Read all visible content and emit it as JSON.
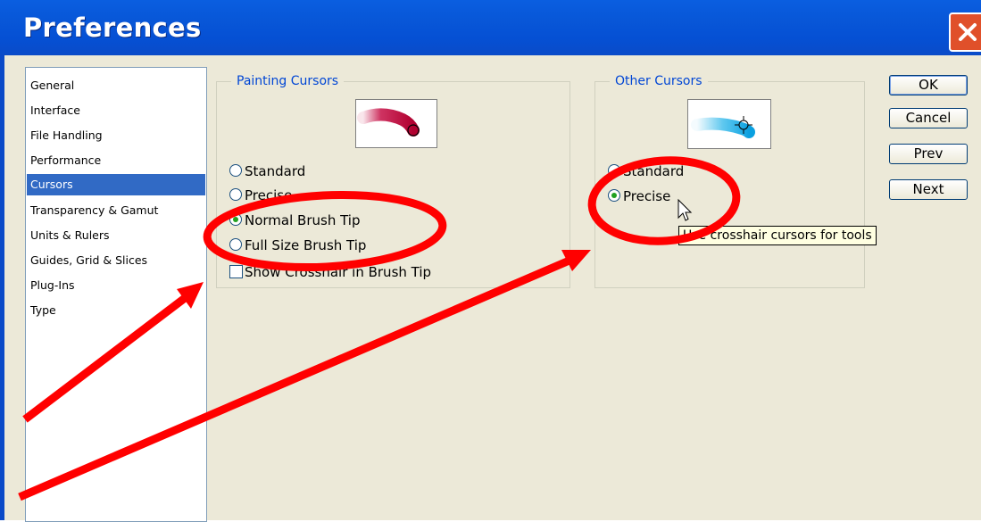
{
  "window": {
    "title": "Preferences"
  },
  "categories": [
    {
      "label": "General",
      "selected": false
    },
    {
      "label": "Interface",
      "selected": false
    },
    {
      "label": "File Handling",
      "selected": false
    },
    {
      "label": "Performance",
      "selected": false
    },
    {
      "label": "Cursors",
      "selected": true
    },
    {
      "label": "Transparency & Gamut",
      "selected": false
    },
    {
      "label": "Units & Rulers",
      "selected": false
    },
    {
      "label": "Guides, Grid & Slices",
      "selected": false
    },
    {
      "label": "Plug-Ins",
      "selected": false
    },
    {
      "label": "Type",
      "selected": false
    }
  ],
  "painting_cursors": {
    "legend": "Painting Cursors",
    "options": [
      {
        "label": "Standard",
        "selected": false
      },
      {
        "label": "Precise",
        "selected": false
      },
      {
        "label": "Normal Brush Tip",
        "selected": true
      },
      {
        "label": "Full Size Brush Tip",
        "selected": false
      }
    ],
    "crosshair_checkbox": {
      "label": "Show Crosshair in Brush Tip",
      "checked": false
    }
  },
  "other_cursors": {
    "legend": "Other Cursors",
    "options": [
      {
        "label": "Standard",
        "selected": false
      },
      {
        "label": "Precise",
        "selected": true
      }
    ]
  },
  "buttons": {
    "ok": "OK",
    "cancel": "Cancel",
    "prev": "Prev",
    "next": "Next"
  },
  "tooltip": "Use crosshair cursors for tools",
  "annotation": {
    "color": "#ff0000",
    "style": "red ellipses and arrows"
  }
}
